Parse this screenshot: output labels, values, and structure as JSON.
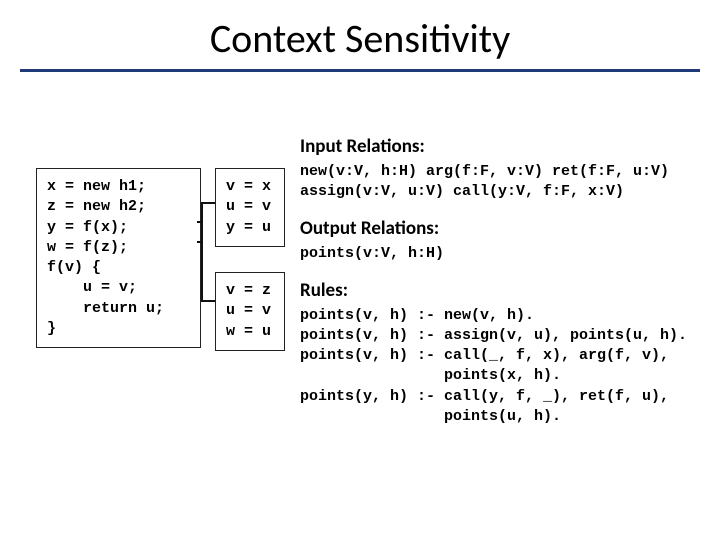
{
  "title": "Context Sensitivity",
  "code": {
    "left": "x = new h1;\nz = new h2;\ny = f(x);\nw = f(z);\nf(v) {\n    u = v;\n    return u;\n}",
    "mid_top": "v = x\nu = v\ny = u",
    "mid_bot": "v = z\nu = v\nw = u"
  },
  "sections": {
    "input_head": "Input Relations:",
    "input_body": "new(v:V, h:H) arg(f:F, v:V) ret(f:F, u:V)\nassign(v:V, u:V) call(y:V, f:F, x:V)",
    "output_head": "Output Relations:",
    "output_body": "points(v:V, h:H)",
    "rules_head": "Rules:",
    "rules_body": "points(v, h) :- new(v, h).\npoints(v, h) :- assign(v, u), points(u, h).\npoints(v, h) :- call(_, f, x), arg(f, v),\n                points(x, h).\npoints(y, h) :- call(y, f, _), ret(f, u),\n                points(u, h)."
  }
}
